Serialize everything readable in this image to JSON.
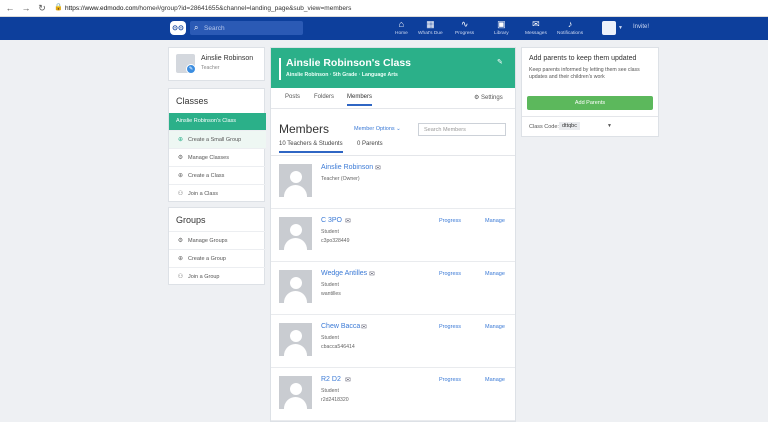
{
  "browser": {
    "back_icon": "back-arrow-icon",
    "url_host": "https://www.edmodo.com",
    "url_path": "/home#/group?id=28641655&channel=landing_page&sub_view=members"
  },
  "topnav": {
    "logo_text": "⊙⊙",
    "search_placeholder": "Search",
    "items": [
      {
        "label": "Home",
        "icon": "home-icon"
      },
      {
        "label": "What's Due",
        "icon": "calendar-icon"
      },
      {
        "label": "Progress",
        "icon": "progress-icon"
      },
      {
        "label": "Library",
        "icon": "library-icon"
      },
      {
        "label": "Messages",
        "icon": "messages-icon"
      },
      {
        "label": "Notifications",
        "icon": "bell-icon"
      }
    ],
    "invite": "Invite!"
  },
  "profile": {
    "name": "Ainslie Robinson",
    "role": "Teacher"
  },
  "classes": {
    "title": "Classes",
    "active": "Ainslie Robinson's Class",
    "items": [
      "Create a Small Group",
      "Manage Classes",
      "Create a Class",
      "Join a Class"
    ]
  },
  "groups": {
    "title": "Groups",
    "items": [
      "Manage Groups",
      "Create a Group",
      "Join a Group"
    ]
  },
  "class_header": {
    "title": "Ainslie Robinson's Class",
    "subtitle": "Ainslie Robinson · 5th Grade · Language Arts"
  },
  "tabs": {
    "posts": "Posts",
    "folders": "Folders",
    "members": "Members",
    "settings": "Settings"
  },
  "members": {
    "title": "Members",
    "options": "Member Options ⌄",
    "search_placeholder": "Search Members",
    "subtab_students": "10 Teachers & Students",
    "subtab_parents": "0 Parents",
    "list": [
      {
        "name": "Ainslie Robinson",
        "role": "Teacher (Owner)",
        "username": "",
        "progress": "",
        "manage": ""
      },
      {
        "name": "C 3PO",
        "role": "Student",
        "username": "c3po328449",
        "progress": "Progress",
        "manage": "Manage"
      },
      {
        "name": "Wedge Antilles",
        "role": "Student",
        "username": "wantilles",
        "progress": "Progress",
        "manage": "Manage"
      },
      {
        "name": "Chew Bacca",
        "role": "Student",
        "username": "cbacca546414",
        "progress": "Progress",
        "manage": "Manage"
      },
      {
        "name": "R2 D2",
        "role": "Student",
        "username": "r2d2418320",
        "progress": "Progress",
        "manage": "Manage"
      }
    ]
  },
  "parents_panel": {
    "heading": "Add parents to keep them updated",
    "description": "Keep parents informed by letting them see class updates and their children's work",
    "button": "Add Parents",
    "code_label": "Class Code:",
    "code": "dttqbc"
  },
  "colors": {
    "nav": "#0d3f9c",
    "accent": "#2bb089",
    "link": "#3b7ad6",
    "button": "#5cb85c"
  }
}
